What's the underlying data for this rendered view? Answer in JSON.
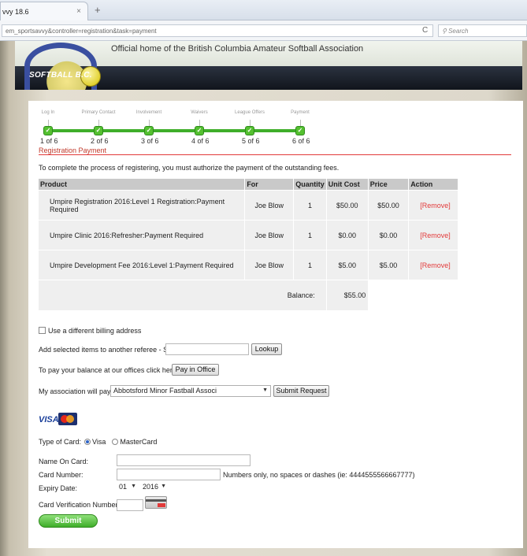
{
  "browser": {
    "tab_title": "vvy 18.6",
    "tab_close": "×",
    "new_tab": "+",
    "url": "em_sportsavvy&controller=registration&task=payment",
    "reload": "C",
    "search_placeholder": "Search"
  },
  "header": {
    "tagline": "Official home of the British Columbia Amateur Softball Association",
    "logo_text": "SOFTBALL B.C."
  },
  "steps": [
    {
      "label": "Log In",
      "num": "1 of 6"
    },
    {
      "label": "Primary Contact",
      "num": "2 of 6"
    },
    {
      "label": "Involvement",
      "num": "3 of 6"
    },
    {
      "label": "Waivers",
      "num": "4 of 6"
    },
    {
      "label": "League Offers",
      "num": "5 of 6"
    },
    {
      "label": "Payment",
      "num": "6 of 6"
    }
  ],
  "page": {
    "section_title": "Registration Payment",
    "intro": "To complete the process of registering, you must authorize the payment of the outstanding fees."
  },
  "table": {
    "headers": {
      "product": "Product",
      "for": "For",
      "quantity": "Quantity",
      "unit_cost": "Unit Cost",
      "price": "Price",
      "action": "Action"
    },
    "rows": [
      {
        "product": "Umpire Registration 2016:Level 1 Registration:Payment Required",
        "for": "Joe Blow",
        "quantity": "1",
        "unit_cost": "$50.00",
        "price": "$50.00",
        "action": "[Remove]"
      },
      {
        "product": "Umpire Clinic 2016:Refresher:Payment Required",
        "for": "Joe Blow",
        "quantity": "1",
        "unit_cost": "$0.00",
        "price": "$0.00",
        "action": "[Remove]"
      },
      {
        "product": "Umpire Development Fee 2016:Level 1:Payment Required",
        "for": "Joe Blow",
        "quantity": "1",
        "unit_cost": "$5.00",
        "price": "$5.00",
        "action": "[Remove]"
      }
    ],
    "balance_label": "Balance:",
    "balance_value": "$55.00"
  },
  "billing": {
    "different_address_label": "Use a different billing address",
    "add_items_label": "Add selected items to another referee - SBC#:",
    "sbc_value": "",
    "lookup_button": "Lookup",
    "pay_office_label": "To pay your balance at our offices click here:",
    "pay_office_button": "Pay in Office",
    "association_label": "My association will pay:",
    "association_selected": "Abbotsford Minor Fastball Associ",
    "submit_request_button": "Submit Request"
  },
  "card": {
    "visa_logo": "VISA",
    "type_label": "Type of Card:",
    "visa_option": "Visa",
    "mastercard_option": "MasterCard",
    "name_label": "Name On Card:",
    "name_value": "",
    "number_label": "Card Number:",
    "number_value": "",
    "number_hint": "Numbers only, no spaces or dashes (ie: 4444555566667777)",
    "expiry_label": "Expiry Date:",
    "expiry_month": "01",
    "expiry_year": "2016",
    "cvv_label": "Card Verification Number:",
    "cvv_value": "",
    "submit_button": "Submit"
  },
  "colors": {
    "accent_red": "#e23a3a",
    "progress_green": "#3fae2a",
    "header_dark": "#11151c"
  }
}
